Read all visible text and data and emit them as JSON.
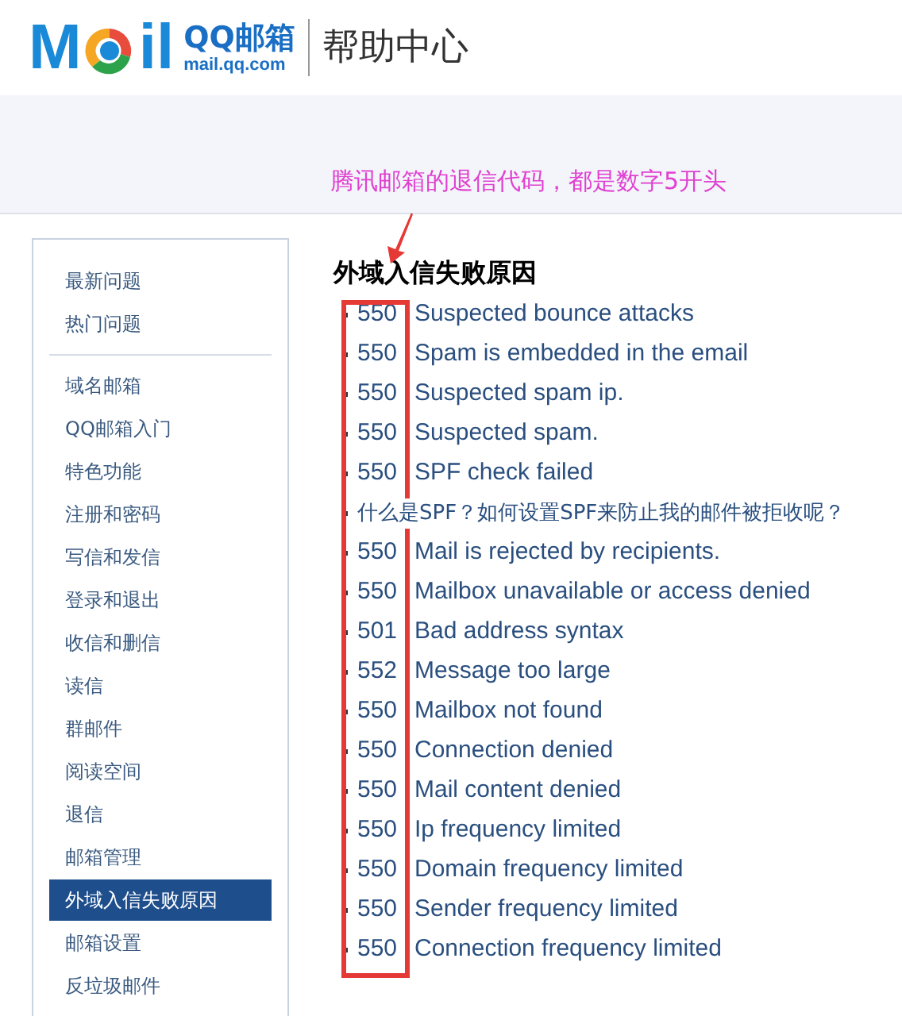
{
  "header": {
    "logo_left": "M",
    "logo_right": "il",
    "brand": "QQ邮箱",
    "domain": "mail.qq.com",
    "section": "帮助中心"
  },
  "annotation": {
    "text": "腾讯邮箱的退信代码，都是数字5开头"
  },
  "sidebar": {
    "groups": [
      [
        {
          "label": "最新问题",
          "selected": false
        },
        {
          "label": "热门问题",
          "selected": false
        }
      ],
      [
        {
          "label": "域名邮箱",
          "selected": false
        },
        {
          "label": "QQ邮箱入门",
          "selected": false
        },
        {
          "label": "特色功能",
          "selected": false
        },
        {
          "label": "注册和密码",
          "selected": false
        },
        {
          "label": "写信和发信",
          "selected": false
        },
        {
          "label": "登录和退出",
          "selected": false
        },
        {
          "label": "收信和删信",
          "selected": false
        },
        {
          "label": "读信",
          "selected": false
        },
        {
          "label": "群邮件",
          "selected": false
        },
        {
          "label": "阅读空间",
          "selected": false
        },
        {
          "label": "退信",
          "selected": false
        },
        {
          "label": "邮箱管理",
          "selected": false
        },
        {
          "label": "外域入信失败原因",
          "selected": true
        },
        {
          "label": "邮箱设置",
          "selected": false
        },
        {
          "label": "反垃圾邮件",
          "selected": false
        }
      ]
    ]
  },
  "article": {
    "title": "外域入信失败原因",
    "items": [
      {
        "kind": "code",
        "code": "550",
        "message": "Suspected bounce attacks"
      },
      {
        "kind": "code",
        "code": "550",
        "message": "Spam is embedded in the email"
      },
      {
        "kind": "code",
        "code": "550",
        "message": "Suspected spam ip."
      },
      {
        "kind": "code",
        "code": "550",
        "message": "Suspected spam."
      },
      {
        "kind": "code",
        "code": "550",
        "message": "SPF check failed"
      },
      {
        "kind": "link",
        "text": "什么是SPF？如何设置SPF来防止我的邮件被拒收呢？"
      },
      {
        "kind": "code",
        "code": "550",
        "message": "Mail is rejected by recipients."
      },
      {
        "kind": "code",
        "code": "550",
        "message": "Mailbox unavailable or access denied"
      },
      {
        "kind": "code",
        "code": "501",
        "message": "Bad address syntax"
      },
      {
        "kind": "code",
        "code": "552",
        "message": "Message too large"
      },
      {
        "kind": "code",
        "code": "550",
        "message": "Mailbox not found"
      },
      {
        "kind": "code",
        "code": "550",
        "message": "Connection denied"
      },
      {
        "kind": "code",
        "code": "550",
        "message": "Mail content denied"
      },
      {
        "kind": "code",
        "code": "550",
        "message": "Ip frequency limited"
      },
      {
        "kind": "code",
        "code": "550",
        "message": "Domain frequency limited"
      },
      {
        "kind": "code",
        "code": "550",
        "message": "Sender frequency limited"
      },
      {
        "kind": "code",
        "code": "550",
        "message": "Connection frequency limited"
      }
    ]
  }
}
